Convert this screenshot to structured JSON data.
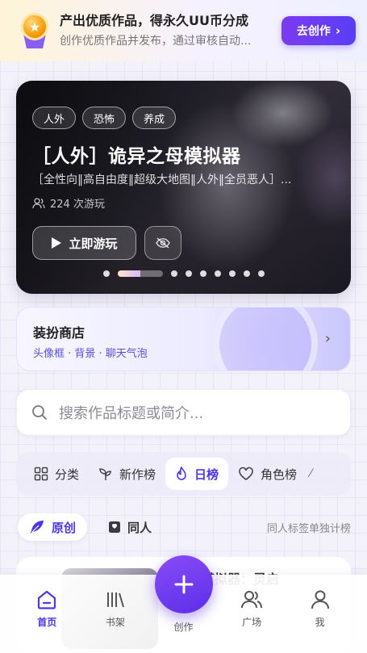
{
  "promo": {
    "title": "产出优质作品，得永久UU币分成",
    "subtitle": "创作优质作品并发布，通过审核自动...",
    "button": "去创作",
    "medal_icon": "star-medal-icon"
  },
  "hero": {
    "tags": [
      "人外",
      "恐怖",
      "养成"
    ],
    "title": "［人外］诡异之母模拟器",
    "description": "［全性向‖高自由度‖超级大地图‖人外‖全员恶人］...",
    "plays": "224 次游玩",
    "play_button": "立即游玩",
    "carousel": {
      "total": 9,
      "active_index": 1
    }
  },
  "shop": {
    "title": "装扮商店",
    "subtitle": "头像框 · 背景 · 聊天气泡"
  },
  "search": {
    "placeholder": "搜索作品标题或简介..."
  },
  "rank_tabs": [
    {
      "label": "分类",
      "icon": "grid-icon",
      "active": false
    },
    {
      "label": "新作榜",
      "icon": "sprout-icon",
      "active": false
    },
    {
      "label": "日榜",
      "icon": "flame-icon",
      "active": true
    },
    {
      "label": "角色榜",
      "icon": "heart-icon",
      "active": false
    }
  ],
  "sub_tabs": [
    {
      "label": "原创",
      "icon": "feather-icon",
      "active": true
    },
    {
      "label": "同人",
      "icon": "book-icon",
      "active": false
    }
  ],
  "side_note": "同人标签单独计榜",
  "peek_card": {
    "title_fragment": "模拟器：灵启"
  },
  "nav": {
    "items": [
      {
        "label": "首页",
        "icon": "home-icon",
        "active": true
      },
      {
        "label": "书架",
        "icon": "bookshelf-icon",
        "active": false
      },
      {
        "label": "创作",
        "icon": "plus-icon",
        "active": false
      },
      {
        "label": "广场",
        "icon": "users-icon",
        "active": false
      },
      {
        "label": "我",
        "icon": "user-icon",
        "active": false
      }
    ]
  },
  "colors": {
    "accent": "#4c38e6",
    "accent_gradient_start": "#7b3cf0",
    "accent_gradient_end": "#5a3df5"
  }
}
